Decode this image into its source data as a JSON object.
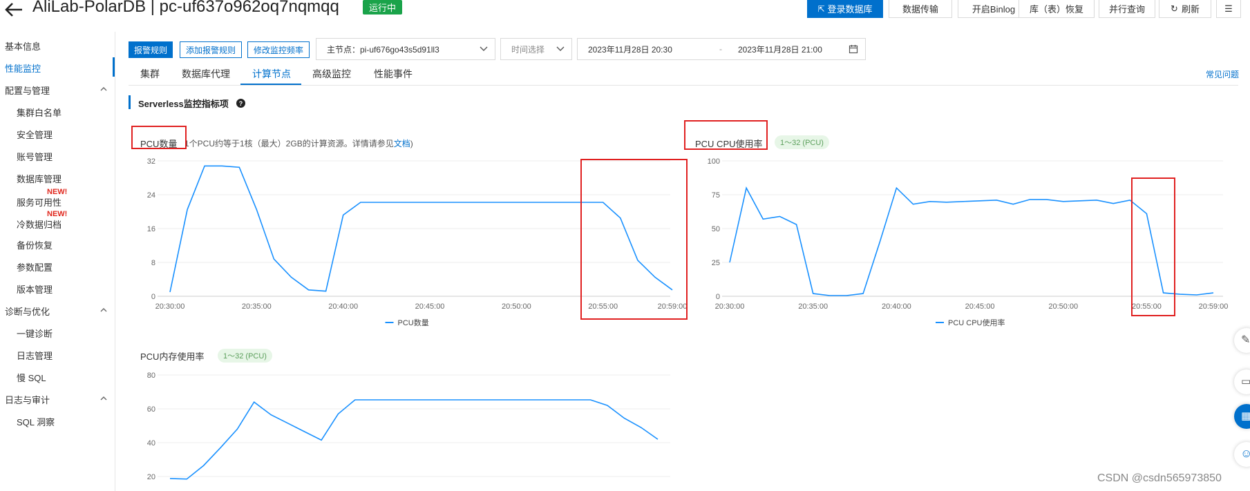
{
  "header": {
    "title": "AliLab-PolarDB | pc-uf637o962oq7nqmqq",
    "status": "运行中",
    "buttons": [
      {
        "label": "登录数据库",
        "primary": true
      },
      {
        "label": "数据传输"
      },
      {
        "label": "开启Binlog"
      },
      {
        "label": "库（表）恢复"
      },
      {
        "label": "并行查询"
      },
      {
        "label": "刷新"
      }
    ]
  },
  "sidebar": {
    "items": [
      {
        "label": "基本信息",
        "level": "group"
      },
      {
        "label": "性能监控",
        "level": "group",
        "active": true
      },
      {
        "label": "配置与管理",
        "level": "group",
        "expanded": true
      },
      {
        "label": "集群白名单",
        "level": "sub"
      },
      {
        "label": "安全管理",
        "level": "sub"
      },
      {
        "label": "账号管理",
        "level": "sub"
      },
      {
        "label": "数据库管理",
        "level": "sub"
      },
      {
        "label": "服务可用性",
        "level": "sub",
        "badge": "NEW!"
      },
      {
        "label": "冷数据归档",
        "level": "sub",
        "badge": "NEW!"
      },
      {
        "label": "备份恢复",
        "level": "sub"
      },
      {
        "label": "参数配置",
        "level": "sub"
      },
      {
        "label": "版本管理",
        "level": "sub"
      },
      {
        "label": "诊断与优化",
        "level": "group",
        "expanded": true
      },
      {
        "label": "一键诊断",
        "level": "sub"
      },
      {
        "label": "日志管理",
        "level": "sub"
      },
      {
        "label": "慢 SQL",
        "level": "sub"
      },
      {
        "label": "日志与审计",
        "level": "group",
        "expanded": true
      },
      {
        "label": "SQL 洞察",
        "level": "sub"
      }
    ]
  },
  "toolbar": {
    "alarm_rules": "报警规则",
    "add_alarm_rule": "添加报警规则",
    "modify_frequency": "修改监控频率",
    "node_select": "主节点：pi-uf676go43s5d91ll3",
    "time_select": "时间选择",
    "start_time": "2023年11月28日 20:30",
    "range_sep": "-",
    "end_time": "2023年11月28日 21:00"
  },
  "tabs": [
    "集群",
    "数据库代理",
    "计算节点",
    "高级监控",
    "性能事件"
  ],
  "active_tab": "计算节点",
  "faq_link": "常见问题",
  "section_title": "Serverless监控指标项",
  "pcu_note": "1个PCU约等于1核（最大）2GB的计算资源。详情请参见",
  "pcu_note_link": "文档",
  "pcu_note_end": ")",
  "pill_label": "1～32 (PCU)",
  "watermark": "CSDN @csdn565973850",
  "colors": {
    "accent": "#0070cc",
    "line": "#1890ff",
    "highlight": "#e02020",
    "status": "#1aa34a"
  },
  "chart_data": [
    {
      "type": "line",
      "title": "PCU数量",
      "x": [
        "20:30:00",
        "20:31:00",
        "20:32:00",
        "20:33:00",
        "20:34:00",
        "20:35:00",
        "20:36:00",
        "20:37:00",
        "20:38:00",
        "20:39:00",
        "20:40:00",
        "20:41:00",
        "20:55:00",
        "20:56:00",
        "20:57:00",
        "20:58:00",
        "20:59:00"
      ],
      "xticks": [
        "20:30:00",
        "20:35:00",
        "20:40:00",
        "20:45:00",
        "20:50:00",
        "20:55:00",
        "20:59:00"
      ],
      "series": [
        {
          "name": "PCU数量",
          "values": [
            1,
            20.5,
            30.8,
            30.8,
            30.5,
            20.5,
            8.8,
            4.5,
            1.5,
            1.2,
            19.2,
            22.2,
            22.2,
            18.5,
            8.5,
            4.5,
            1.5
          ]
        }
      ],
      "ylim": [
        0,
        32
      ],
      "yticks": [
        0,
        8,
        16,
        24,
        32
      ]
    },
    {
      "type": "line",
      "title": "PCU CPU使用率",
      "x": [
        "20:30:00",
        "20:31:00",
        "20:32:00",
        "20:33:00",
        "20:34:00",
        "20:35:00",
        "20:36:00",
        "20:37:00",
        "20:38:00",
        "20:39:00",
        "20:40:00",
        "20:41:00",
        "20:42:00",
        "20:43:00",
        "20:44:00",
        "20:45:00",
        "20:46:00",
        "20:47:00",
        "20:48:00",
        "20:49:00",
        "20:50:00",
        "20:51:00",
        "20:52:00",
        "20:53:00",
        "20:54:00",
        "20:55:00",
        "20:56:00",
        "20:57:00",
        "20:58:00",
        "20:59:00"
      ],
      "xticks": [
        "20:30:00",
        "20:35:00",
        "20:40:00",
        "20:45:00",
        "20:50:00",
        "20:55:00",
        "20:59:00"
      ],
      "series": [
        {
          "name": "PCU CPU使用率",
          "values": [
            25,
            80,
            57,
            59,
            53,
            2,
            0.5,
            0.5,
            2,
            40,
            80,
            68,
            70,
            69.5,
            70,
            70.5,
            71,
            68,
            71.5,
            71.5,
            70,
            70.5,
            71,
            68.5,
            71,
            61,
            2.5,
            1.5,
            1,
            2.5
          ]
        }
      ],
      "ylim": [
        0,
        100
      ],
      "yticks": [
        0,
        25,
        50,
        75,
        100
      ]
    },
    {
      "type": "line",
      "title": "PCU内存使用率",
      "x": [
        "20:30:00",
        "20:31:00",
        "20:32:00",
        "20:33:00",
        "20:34:00",
        "20:35:00",
        "20:36:00",
        "20:37:00",
        "20:38:00",
        "20:39:00",
        "20:40:00",
        "20:41:00",
        "20:55:00",
        "20:56:00",
        "20:57:00",
        "20:58:00",
        "20:59:00"
      ],
      "series": [
        {
          "name": "PCU内存使用率",
          "values": [
            18.8,
            18.5,
            26.5,
            37,
            48,
            64,
            56.5,
            51.5,
            46.5,
            41.5,
            57,
            65.3,
            65.3,
            62,
            54.5,
            49,
            42
          ]
        }
      ],
      "yticks": [
        20,
        40,
        60,
        80
      ]
    }
  ]
}
